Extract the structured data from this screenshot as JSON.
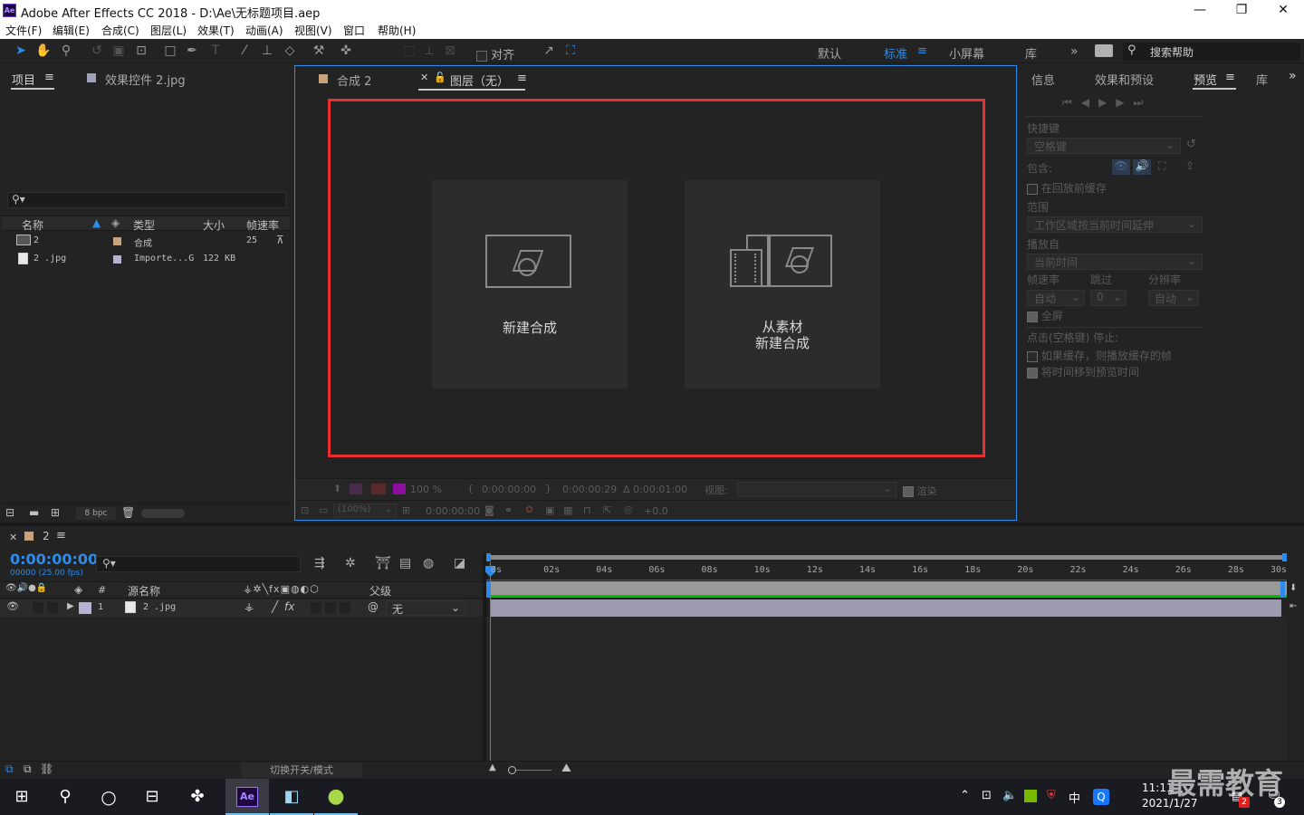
{
  "window": {
    "title": "Adobe After Effects CC 2018 - D:\\Ae\\无标题项目.aep",
    "logo": "Ae"
  },
  "menu": [
    "文件(F)",
    "编辑(E)",
    "合成(C)",
    "图层(L)",
    "效果(T)",
    "动画(A)",
    "视图(V)",
    "窗口",
    "帮助(H)"
  ],
  "toolbar": {
    "align_label": "对齐",
    "workspaces": [
      "默认",
      "标准",
      "小屏幕",
      "库"
    ],
    "active_workspace": "标准",
    "search_placeholder": "搜索帮助"
  },
  "project": {
    "tabs": [
      "项目",
      "效果控件 2.jpg"
    ],
    "columns": [
      "名称",
      "类型",
      "大小",
      "帧速率"
    ],
    "rows": [
      {
        "name": "2",
        "type": "合成",
        "size": "",
        "fps": "25"
      },
      {
        "name": "2 .jpg",
        "type": "Importe...G",
        "size": "122 KB",
        "fps": ""
      }
    ],
    "bpc": "8 bpc"
  },
  "viewer": {
    "tabs": [
      "合成 2",
      "图层（无）"
    ],
    "cards": [
      {
        "label_line1": "新建合成",
        "label_line2": ""
      },
      {
        "label_line1": "从素材",
        "label_line2": "新建合成"
      }
    ],
    "footer": {
      "zoom": "100 %",
      "tc_in": "0:00:00:00",
      "tc_out": "0:00:00:29",
      "duration": "Δ 0:00:01:00",
      "view_label": "视图:",
      "render_label": "渲染",
      "mag": "(100%)",
      "tc": "0:00:00:00",
      "exposure": "+0.0"
    }
  },
  "preview": {
    "tabs": [
      "信息",
      "效果和预设",
      "预览",
      "库"
    ],
    "shortcut_label": "快捷键",
    "shortcut_value": "空格键",
    "include_label": "包含:",
    "cache_before": "在回放前缓存",
    "range_label": "范围",
    "range_value": "工作区域按当前时间延伸",
    "play_from_label": "播放自",
    "play_from_value": "当前时间",
    "fps_label": "帧速率",
    "skip_label": "跳过",
    "res_label": "分辨率",
    "fps_value": "自动",
    "skip_value": "0",
    "res_value": "自动",
    "fullscreen": "全屏",
    "stop_label": "点击(空格键) 停止:",
    "opt1": "如果缓存，则播放缓存的帧",
    "opt2": "将时间移到预览时间"
  },
  "timeline": {
    "tab": "2",
    "timecode": "0:00:00:00",
    "frames": "00000 (25.00 fps)",
    "source_col": "源名称",
    "parent_col": "父级",
    "layer": {
      "index": "1",
      "name": "2 .jpg",
      "parent": "无"
    },
    "ruler": [
      "0s",
      "02s",
      "04s",
      "06s",
      "08s",
      "10s",
      "12s",
      "14s",
      "16s",
      "18s",
      "20s",
      "22s",
      "24s",
      "26s",
      "28s",
      "30s"
    ],
    "switch_label": "切换开关/模式"
  },
  "taskbar": {
    "time": "11:11",
    "date": "2021/1/27",
    "ime": "中",
    "notif1": "2",
    "notif2": "3",
    "watermark": "最需教育"
  },
  "colors": {
    "accent": "#2d8ceb",
    "highlight_border": "#e8302f",
    "timecode": "#2d8ceb",
    "work_bar": "#00c000"
  }
}
